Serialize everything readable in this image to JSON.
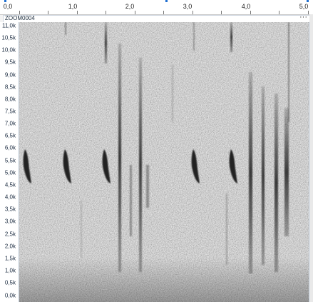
{
  "window": {
    "title": "ZOOM0004",
    "menu_glyph": "···"
  },
  "time_ruler": {
    "labels": [
      "0,0",
      "1,0",
      "2,0",
      "3,0",
      "4,0",
      "5,0"
    ],
    "unit": "seconds"
  },
  "frequency_axis": {
    "labels": [
      "11,0k",
      "10,5k",
      "10,0k",
      "9,5k",
      "9,0k",
      "8,5k",
      "8,0k",
      "7,5k",
      "7,0k",
      "6,5k",
      "6,0k",
      "5,5k",
      "5,0k",
      "4,5k",
      "4,0k",
      "3,5k",
      "3,0k",
      "2,5k",
      "2,0k",
      "1,5k",
      "1,0k",
      "0,5k",
      "0,0k"
    ]
  },
  "spectrogram": {
    "colors": {
      "background": "#e2e2e2",
      "ink": "#202020"
    }
  }
}
